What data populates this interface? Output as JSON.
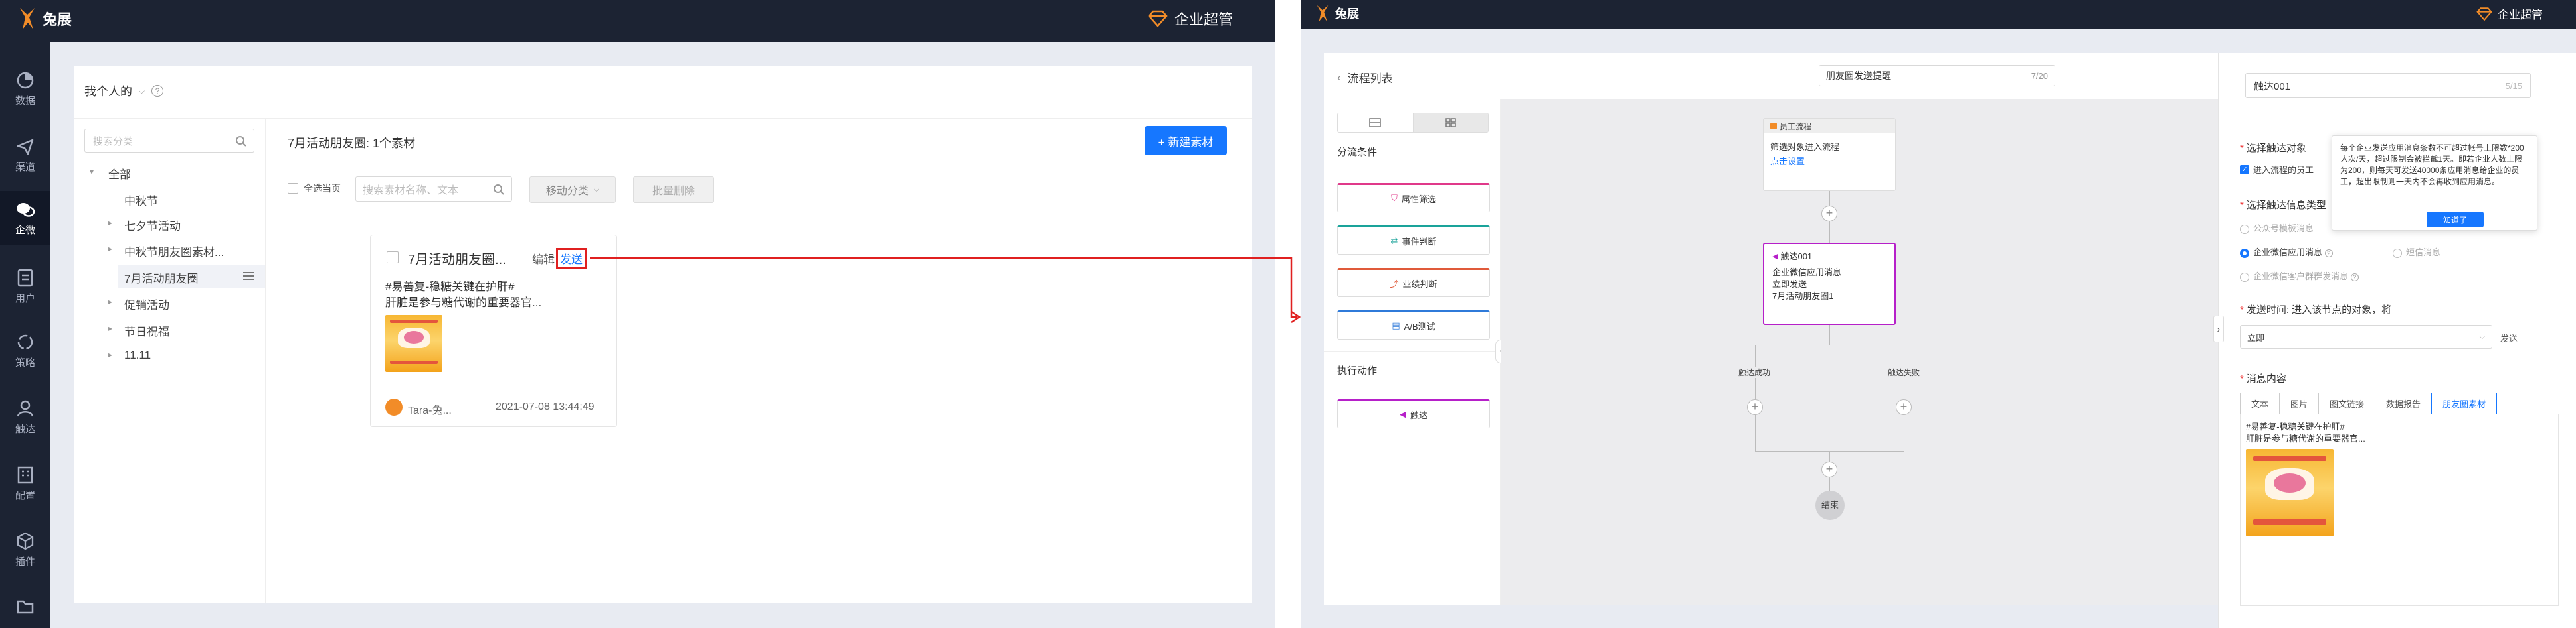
{
  "left": {
    "app_logo": "兔展",
    "vip_label": "企业超管",
    "nav": [
      {
        "label": "数据",
        "icon": "dashboard-icon"
      },
      {
        "label": "渠道",
        "icon": "send-icon"
      },
      {
        "label": "企微",
        "icon": "chat-icon",
        "active": true
      },
      {
        "label": "用户",
        "icon": "user-card-icon"
      },
      {
        "label": "策略",
        "icon": "cycle-icon"
      },
      {
        "label": "触达",
        "icon": "person-icon"
      },
      {
        "label": "配置",
        "icon": "building-icon"
      },
      {
        "label": "插件",
        "icon": "cube-icon"
      },
      {
        "label": "",
        "icon": "folder-icon"
      }
    ],
    "scope_label": "我个人的",
    "category_search_placeholder": "搜索分类",
    "tree": {
      "all": "全部",
      "items": [
        {
          "label": "中秋节",
          "caret": false
        },
        {
          "label": "七夕节活动",
          "caret": true
        },
        {
          "label": "中秋节朋友圈素材...",
          "caret": true
        },
        {
          "label": "7月活动朋友圈",
          "caret": false,
          "selected": true
        },
        {
          "label": "促销活动",
          "caret": true
        },
        {
          "label": "节日祝福",
          "caret": true
        },
        {
          "label": "11.11",
          "caret": true
        }
      ]
    },
    "header_title": "7月活动朋友圈: 1个素材",
    "new_button": "+ 新建素材",
    "select_all": "全选当页",
    "material_search_placeholder": "搜索素材名称、文本",
    "move_category": "移动分类",
    "batch_delete": "批量删除",
    "card": {
      "title": "7月活动朋友圈...",
      "edit": "编辑",
      "send": "发送",
      "text_line1": "#易善复-稳糖关键在护肝#",
      "text_line2": "肝脏是参与糖代谢的重要器官...",
      "author": "Tara-兔...",
      "timestamp": "2021-07-08 13:44:49"
    }
  },
  "right": {
    "app_logo": "兔展",
    "vip_label": "企业超管",
    "back_label": "流程列表",
    "flow_name_value": "朋友圈发送提醒",
    "flow_name_count": "7/20",
    "filter_section": "分流条件",
    "filters": [
      {
        "label": "属性筛选",
        "color": "#e0398a",
        "icon": "filter-icon"
      },
      {
        "label": "事件判断",
        "color": "#1aa39a",
        "icon": "event-icon"
      },
      {
        "label": "业绩判断",
        "color": "#e05a3a",
        "icon": "chart-icon"
      },
      {
        "label": "A/B测试",
        "color": "#2f7ad9",
        "icon": "ab-icon"
      }
    ],
    "action_section": "执行动作",
    "action_item": {
      "label": "触达",
      "color": "#b620c9",
      "icon": "megaphone-icon"
    },
    "flow": {
      "start_header": "员工流程",
      "start_line": "筛选对象进入流程",
      "start_link": "点击设置",
      "touch_title": "触达001",
      "touch_lines": [
        "企业微信应用消息",
        "立即发送",
        "7月活动朋友圈1"
      ],
      "branch_success": "触达成功",
      "branch_fail": "触达失败",
      "end_label": "结束"
    },
    "config": {
      "name_value": "触达001",
      "name_count": "5/15",
      "target_label": "选择触达对象",
      "target_option": "进入流程的员工",
      "channel_label": "选择触达信息类型",
      "channels": [
        {
          "label": "公众号模板消息",
          "checked": false
        },
        {
          "label": "企业微信应用消息",
          "checked": true
        },
        {
          "label": "企业微信客户群群发消息",
          "checked": false
        }
      ],
      "sms_label": "短信消息",
      "tooltip_text": "每个企业发送应用消息条数不可超过帐号上限数*200人次/天，超过限制会被拦截1天。即若企业人数上限为200，则每天可发送40000条应用消息给企业的员工，超出限制则一天内不会再收到应用消息。",
      "tooltip_button": "知道了",
      "send_time_label": "发送时间: 进入该节点的对象，将",
      "send_time_value": "立即",
      "send_suffix": "发送",
      "content_label": "消息内容",
      "content_tabs": [
        "文本",
        "图片",
        "图文链接",
        "数据报告",
        "朋友圈素材"
      ],
      "content_text_line1": "#易善复-稳糖关键在护肝#",
      "content_text_line2": "肝脏是参与糖代谢的重要器官..."
    }
  },
  "colors": {
    "accent": "#1677ff",
    "sidebar": "#1c2333",
    "touch_node": "#b620c9",
    "highlight": "#e02020"
  }
}
